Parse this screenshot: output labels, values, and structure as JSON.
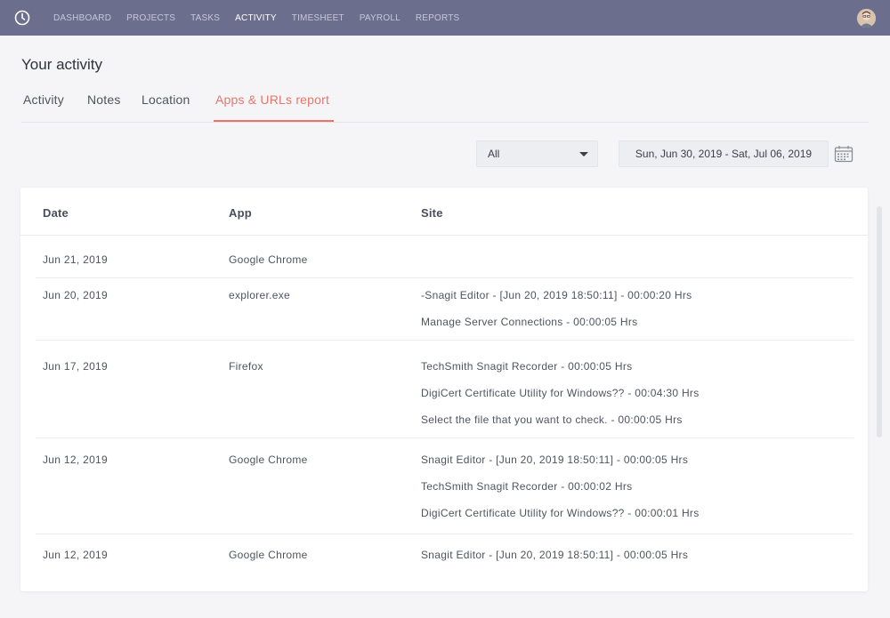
{
  "nav": {
    "items": [
      {
        "label": "DASHBOARD",
        "active": false
      },
      {
        "label": "PROJECTS",
        "active": false
      },
      {
        "label": "TASKS",
        "active": false
      },
      {
        "label": "ACTIVITY",
        "active": true
      },
      {
        "label": "TIMESHEET",
        "active": false
      },
      {
        "label": "PAYROLL",
        "active": false
      },
      {
        "label": "REPORTS",
        "active": false
      }
    ]
  },
  "page": {
    "title": "Your activity"
  },
  "tabs": [
    {
      "label": "Activity",
      "active": false
    },
    {
      "label": "Notes",
      "active": false
    },
    {
      "label": "Location",
      "active": false
    },
    {
      "label": "Apps & URLs report",
      "active": true
    }
  ],
  "filters": {
    "type_select": "All",
    "date_range": "Sun, Jun 30, 2019 - Sat, Jul 06, 2019"
  },
  "table": {
    "headers": {
      "date": "Date",
      "app": "App",
      "site": "Site"
    },
    "rows": [
      {
        "date": "Jun 21, 2019",
        "app": "Google Chrome",
        "sites": []
      },
      {
        "date": "Jun 20, 2019",
        "app": "explorer.exe",
        "sites": [
          "-Snagit Editor - [Jun 20, 2019 18:50:11] - 00:00:20 Hrs",
          "Manage Server Connections - 00:00:05 Hrs"
        ]
      },
      {
        "date": "Jun 17, 2019",
        "app": "Firefox",
        "sites": [
          "TechSmith Snagit Recorder - 00:00:05 Hrs",
          "DigiCert Certificate Utility for Windows?? - 00:04:30 Hrs",
          "Select the file that you want to check. - 00:00:05 Hrs"
        ]
      },
      {
        "date": "Jun 12, 2019",
        "app": "Google Chrome",
        "sites": [
          "Snagit Editor - [Jun 20, 2019 18:50:11] - 00:00:05 Hrs",
          "TechSmith Snagit Recorder - 00:00:02 Hrs",
          "DigiCert Certificate Utility for Windows?? - 00:00:01 Hrs"
        ]
      },
      {
        "date": "Jun 12, 2019",
        "app": "Google Chrome",
        "sites": [
          "Snagit Editor - [Jun 20, 2019 18:50:11] - 00:00:05 Hrs"
        ]
      }
    ]
  },
  "colors": {
    "topbar": "#6b6e8c",
    "accent": "#e7766a"
  },
  "icons": {
    "logo": "clock-icon",
    "calendar": "calendar-icon",
    "dropdown": "caret-down-icon"
  }
}
